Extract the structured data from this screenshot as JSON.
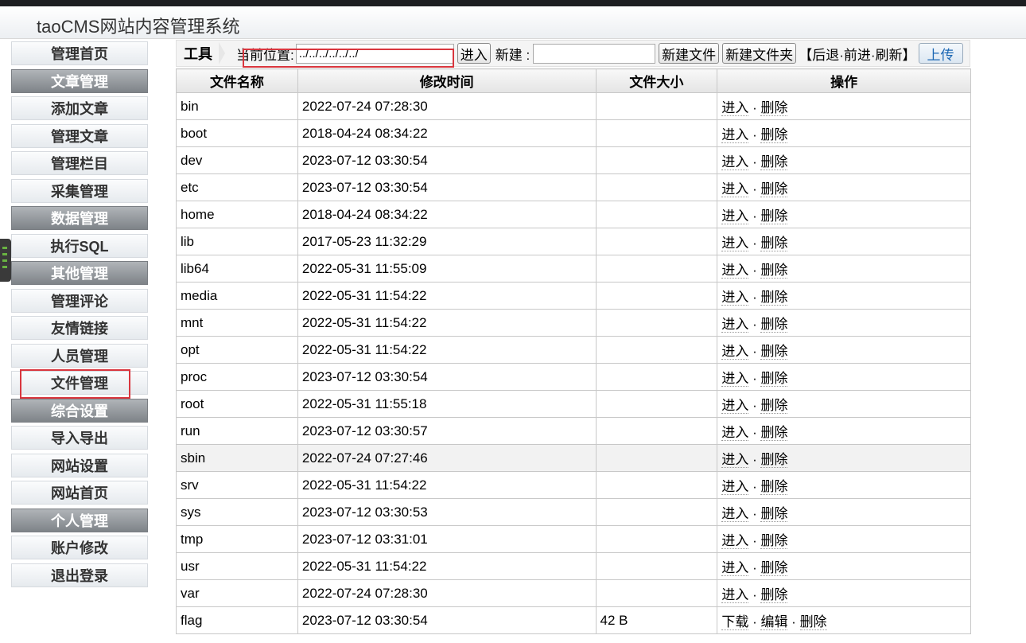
{
  "header": {
    "title": "taoCMS网站内容管理系统"
  },
  "sidebar": {
    "items": [
      {
        "label": "管理首页",
        "type": "item"
      },
      {
        "label": "文章管理",
        "type": "group"
      },
      {
        "label": "添加文章",
        "type": "item"
      },
      {
        "label": "管理文章",
        "type": "item"
      },
      {
        "label": "管理栏目",
        "type": "item"
      },
      {
        "label": "采集管理",
        "type": "item"
      },
      {
        "label": "数据管理",
        "type": "group"
      },
      {
        "label": "执行SQL",
        "type": "item"
      },
      {
        "label": "其他管理",
        "type": "group"
      },
      {
        "label": "管理评论",
        "type": "item"
      },
      {
        "label": "友情链接",
        "type": "item"
      },
      {
        "label": "人员管理",
        "type": "item"
      },
      {
        "label": "文件管理",
        "type": "item"
      },
      {
        "label": "综合设置",
        "type": "group"
      },
      {
        "label": "导入导出",
        "type": "item"
      },
      {
        "label": "网站设置",
        "type": "item"
      },
      {
        "label": "网站首页",
        "type": "item"
      },
      {
        "label": "个人管理",
        "type": "group"
      },
      {
        "label": "账户修改",
        "type": "item"
      },
      {
        "label": "退出登录",
        "type": "item"
      }
    ]
  },
  "toolbar": {
    "title": "工具",
    "path_label": "当前位置:",
    "path_value": "../../../../../../",
    "enter_label": "进入",
    "new_label": "新建 :",
    "new_value": "",
    "new_file_label": "新建文件",
    "new_folder_label": "新建文件夹",
    "bracket_open": "【",
    "back_label": "后退",
    "forward_label": "前进",
    "refresh_label": "刷新",
    "bracket_close": "】",
    "dot": "·",
    "upload_label": "上传"
  },
  "table": {
    "headers": [
      "文件名称",
      "修改时间",
      "文件大小",
      "操作"
    ],
    "enter": "进入",
    "delete": "删除",
    "download": "下载",
    "edit": "编辑",
    "sep": " · ",
    "rows": [
      {
        "name": "bin",
        "time": "2022-07-24 07:28:30",
        "size": "",
        "kind": "dir"
      },
      {
        "name": "boot",
        "time": "2018-04-24 08:34:22",
        "size": "",
        "kind": "dir"
      },
      {
        "name": "dev",
        "time": "2023-07-12 03:30:54",
        "size": "",
        "kind": "dir"
      },
      {
        "name": "etc",
        "time": "2023-07-12 03:30:54",
        "size": "",
        "kind": "dir"
      },
      {
        "name": "home",
        "time": "2018-04-24 08:34:22",
        "size": "",
        "kind": "dir"
      },
      {
        "name": "lib",
        "time": "2017-05-23 11:32:29",
        "size": "",
        "kind": "dir"
      },
      {
        "name": "lib64",
        "time": "2022-05-31 11:55:09",
        "size": "",
        "kind": "dir"
      },
      {
        "name": "media",
        "time": "2022-05-31 11:54:22",
        "size": "",
        "kind": "dir"
      },
      {
        "name": "mnt",
        "time": "2022-05-31 11:54:22",
        "size": "",
        "kind": "dir"
      },
      {
        "name": "opt",
        "time": "2022-05-31 11:54:22",
        "size": "",
        "kind": "dir"
      },
      {
        "name": "proc",
        "time": "2023-07-12 03:30:54",
        "size": "",
        "kind": "dir"
      },
      {
        "name": "root",
        "time": "2022-05-31 11:55:18",
        "size": "",
        "kind": "dir"
      },
      {
        "name": "run",
        "time": "2023-07-12 03:30:57",
        "size": "",
        "kind": "dir"
      },
      {
        "name": "sbin",
        "time": "2022-07-24 07:27:46",
        "size": "",
        "kind": "dir"
      },
      {
        "name": "srv",
        "time": "2022-05-31 11:54:22",
        "size": "",
        "kind": "dir"
      },
      {
        "name": "sys",
        "time": "2023-07-12 03:30:53",
        "size": "",
        "kind": "dir"
      },
      {
        "name": "tmp",
        "time": "2023-07-12 03:31:01",
        "size": "",
        "kind": "dir"
      },
      {
        "name": "usr",
        "time": "2022-05-31 11:54:22",
        "size": "",
        "kind": "dir"
      },
      {
        "name": "var",
        "time": "2022-07-24 07:28:30",
        "size": "",
        "kind": "dir"
      },
      {
        "name": "flag",
        "time": "2023-07-12 03:30:54",
        "size": "42 B",
        "kind": "file"
      }
    ]
  }
}
